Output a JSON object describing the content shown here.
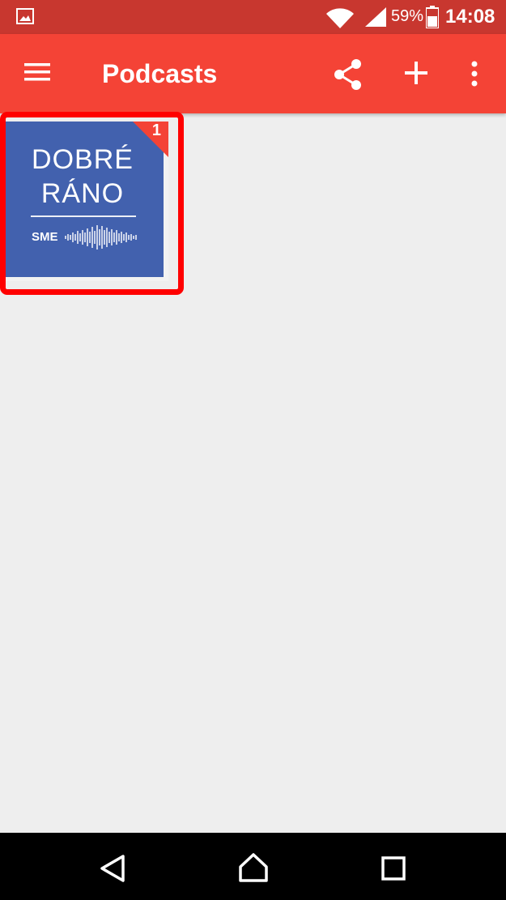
{
  "status_bar": {
    "battery_percent": "59%",
    "time": "14:08",
    "icons": [
      "gallery-icon",
      "wifi-icon",
      "signal-icon",
      "battery-icon"
    ]
  },
  "app_bar": {
    "title": "Podcasts",
    "icons": [
      "menu-icon",
      "share-icon",
      "add-icon",
      "more-vert-icon"
    ]
  },
  "podcasts": [
    {
      "title_line1": "DOBRÉ",
      "title_line2": "RÁNO",
      "brand": "SME",
      "new_episodes": "1"
    }
  ],
  "nav_bar": {
    "icons": [
      "back-icon",
      "home-icon",
      "recents-icon"
    ]
  },
  "colors": {
    "status_bar": "#c8372f",
    "app_bar": "#f44336",
    "tile_background": "#4261ae",
    "highlight": "#ff0000",
    "page_background": "#eeeeee"
  }
}
